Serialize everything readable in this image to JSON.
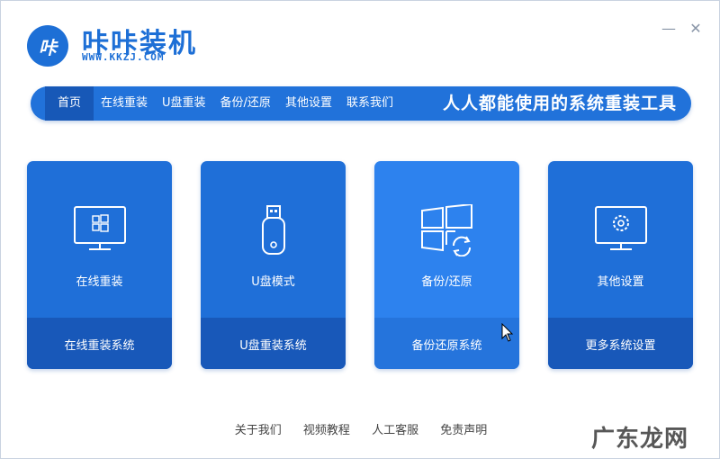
{
  "app": {
    "logo_text": "咔",
    "title": "咔咔装机",
    "url": "WWW.KKZJ.COM",
    "minimize": "—",
    "close": "✕"
  },
  "nav": {
    "items": [
      {
        "label": "首页"
      },
      {
        "label": "在线重装"
      },
      {
        "label": "U盘重装"
      },
      {
        "label": "备份/还原"
      },
      {
        "label": "其他设置"
      },
      {
        "label": "联系我们"
      }
    ],
    "slogan": "人人都能使用的系统重装工具"
  },
  "cards": [
    {
      "title": "在线重装",
      "action": "在线重装系统",
      "icon": "monitor-windows-icon"
    },
    {
      "title": "U盘模式",
      "action": "U盘重装系统",
      "icon": "usb-drive-icon"
    },
    {
      "title": "备份/还原",
      "action": "备份还原系统",
      "icon": "windows-restore-icon"
    },
    {
      "title": "其他设置",
      "action": "更多系统设置",
      "icon": "monitor-gear-icon"
    }
  ],
  "footer": {
    "links": [
      "关于我们",
      "视频教程",
      "人工客服",
      "免责声明"
    ]
  },
  "watermark": "广东龙网",
  "colors": {
    "primary": "#1f6fd8",
    "dark": "#1858b9",
    "highlight": "#2d82ee"
  }
}
